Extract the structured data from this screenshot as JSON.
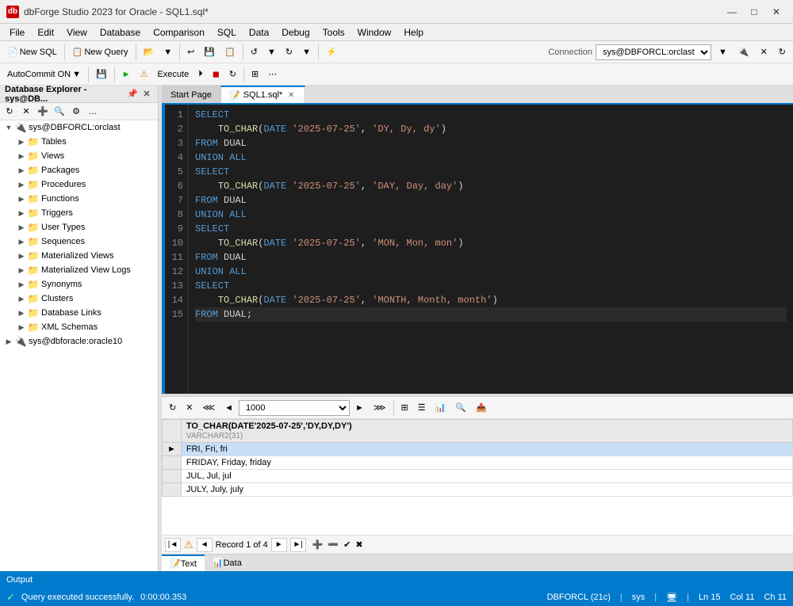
{
  "titlebar": {
    "icon": "db",
    "title": "dbForge Studio 2023 for Oracle - SQL1.sql*",
    "controls": [
      "minimize",
      "maximize",
      "close"
    ]
  },
  "menubar": {
    "items": [
      "File",
      "Edit",
      "View",
      "Database",
      "Comparison",
      "SQL",
      "Data",
      "Debug",
      "Tools",
      "Window",
      "Help"
    ]
  },
  "toolbar1": {
    "new_sql": "New SQL",
    "new_query": "New Query",
    "connection_label": "Connection",
    "connection_value": "sys@DBFORCL:orclast"
  },
  "toolbar2": {
    "autocommit": "AutoCommit ON",
    "execute": "Execute"
  },
  "sidebar": {
    "title": "Database Explorer - sys@DB...",
    "tree": [
      {
        "level": 1,
        "label": "sys@DBFORCL:orclast",
        "type": "connection",
        "expanded": true
      },
      {
        "level": 2,
        "label": "Tables",
        "type": "folder",
        "expanded": false
      },
      {
        "level": 2,
        "label": "Views",
        "type": "folder",
        "expanded": false
      },
      {
        "level": 2,
        "label": "Packages",
        "type": "folder",
        "expanded": false
      },
      {
        "level": 2,
        "label": "Procedures",
        "type": "folder",
        "expanded": false
      },
      {
        "level": 2,
        "label": "Functions",
        "type": "folder",
        "expanded": false
      },
      {
        "level": 2,
        "label": "Triggers",
        "type": "folder",
        "expanded": false
      },
      {
        "level": 2,
        "label": "User Types",
        "type": "folder",
        "expanded": false
      },
      {
        "level": 2,
        "label": "Sequences",
        "type": "folder",
        "expanded": false
      },
      {
        "level": 2,
        "label": "Materialized Views",
        "type": "folder",
        "expanded": false
      },
      {
        "level": 2,
        "label": "Materialized View Logs",
        "type": "folder",
        "expanded": false
      },
      {
        "level": 2,
        "label": "Synonyms",
        "type": "folder",
        "expanded": false
      },
      {
        "level": 2,
        "label": "Clusters",
        "type": "folder",
        "expanded": false
      },
      {
        "level": 2,
        "label": "Database Links",
        "type": "folder",
        "expanded": false
      },
      {
        "level": 2,
        "label": "XML Schemas",
        "type": "folder",
        "expanded": false
      },
      {
        "level": 1,
        "label": "sys@dbforacle:oracle10",
        "type": "connection",
        "expanded": false
      }
    ]
  },
  "tabs": {
    "start_page": "Start Page",
    "sql_file": "SQL1.sql*"
  },
  "editor": {
    "lines": [
      {
        "num": "1",
        "content": "SELECT",
        "tokens": [
          {
            "text": "SELECT",
            "cls": "kw"
          }
        ]
      },
      {
        "num": "2",
        "content": "    TO_CHAR(DATE '2025-07-25', 'DY, Dy, dy')",
        "tokens": [
          {
            "text": "    "
          },
          {
            "text": "TO_CHAR",
            "cls": "fn"
          },
          {
            "text": "(",
            "cls": "punct"
          },
          {
            "text": "DATE",
            "cls": "kw"
          },
          {
            "text": " "
          },
          {
            "text": "'2025-07-25'",
            "cls": "str"
          },
          {
            "text": ", "
          },
          {
            "text": "'DY, Dy, dy'",
            "cls": "str"
          },
          {
            "text": ")",
            "cls": "punct"
          }
        ]
      },
      {
        "num": "3",
        "content": "FROM DUAL",
        "tokens": [
          {
            "text": "FROM",
            "cls": "kw"
          },
          {
            "text": " "
          },
          {
            "text": "DUAL",
            "cls": "txt"
          }
        ]
      },
      {
        "num": "4",
        "content": "UNION ALL",
        "tokens": [
          {
            "text": "UNION ALL",
            "cls": "kw"
          }
        ]
      },
      {
        "num": "5",
        "content": "SELECT",
        "tokens": [
          {
            "text": "SELECT",
            "cls": "kw"
          }
        ]
      },
      {
        "num": "6",
        "content": "    TO_CHAR(DATE '2025-07-25', 'DAY, Day, day')",
        "tokens": [
          {
            "text": "    "
          },
          {
            "text": "TO_CHAR",
            "cls": "fn"
          },
          {
            "text": "(",
            "cls": "punct"
          },
          {
            "text": "DATE",
            "cls": "kw"
          },
          {
            "text": " "
          },
          {
            "text": "'2025-07-25'",
            "cls": "str"
          },
          {
            "text": ", "
          },
          {
            "text": "'DAY, Day, day'",
            "cls": "str"
          },
          {
            "text": ")",
            "cls": "punct"
          }
        ]
      },
      {
        "num": "7",
        "content": "FROM DUAL",
        "tokens": [
          {
            "text": "FROM",
            "cls": "kw"
          },
          {
            "text": " "
          },
          {
            "text": "DUAL",
            "cls": "txt"
          }
        ]
      },
      {
        "num": "8",
        "content": "UNION ALL",
        "tokens": [
          {
            "text": "UNION ALL",
            "cls": "kw"
          }
        ]
      },
      {
        "num": "9",
        "content": "SELECT",
        "tokens": [
          {
            "text": "SELECT",
            "cls": "kw"
          }
        ]
      },
      {
        "num": "10",
        "content": "    TO_CHAR(DATE '2025-07-25', 'MON, Mon, mon')",
        "tokens": [
          {
            "text": "    "
          },
          {
            "text": "TO_CHAR",
            "cls": "fn"
          },
          {
            "text": "(",
            "cls": "punct"
          },
          {
            "text": "DATE",
            "cls": "kw"
          },
          {
            "text": " "
          },
          {
            "text": "'2025-07-25'",
            "cls": "str"
          },
          {
            "text": ", "
          },
          {
            "text": "'MON, Mon, mon'",
            "cls": "str"
          },
          {
            "text": ")",
            "cls": "punct"
          }
        ]
      },
      {
        "num": "11",
        "content": "FROM DUAL",
        "tokens": [
          {
            "text": "FROM",
            "cls": "kw"
          },
          {
            "text": " "
          },
          {
            "text": "DUAL",
            "cls": "txt"
          }
        ]
      },
      {
        "num": "12",
        "content": "UNION ALL",
        "tokens": [
          {
            "text": "UNION ALL",
            "cls": "kw"
          }
        ]
      },
      {
        "num": "13",
        "content": "SELECT",
        "tokens": [
          {
            "text": "SELECT",
            "cls": "kw"
          }
        ]
      },
      {
        "num": "14",
        "content": "    TO_CHAR(DATE '2025-07-25', 'MONTH, Month, month')",
        "tokens": [
          {
            "text": "    "
          },
          {
            "text": "TO_CHAR",
            "cls": "fn"
          },
          {
            "text": "(",
            "cls": "punct"
          },
          {
            "text": "DATE",
            "cls": "kw"
          },
          {
            "text": " "
          },
          {
            "text": "'2025-07-25'",
            "cls": "str"
          },
          {
            "text": ", "
          },
          {
            "text": "'MONTH, Month, month'",
            "cls": "str"
          },
          {
            "text": ")",
            "cls": "punct"
          }
        ]
      },
      {
        "num": "15",
        "content": "FROM DUAL;",
        "tokens": [
          {
            "text": "FROM",
            "cls": "kw"
          },
          {
            "text": " "
          },
          {
            "text": "DUAL",
            "cls": "txt"
          },
          {
            "text": ";",
            "cls": "punct"
          }
        ],
        "is_current": true
      }
    ]
  },
  "results": {
    "toolbar": {
      "limit_value": "1000"
    },
    "column_header": "TO_CHAR(DATE'2025-07-25','DY,DY,DY')",
    "column_type": "VARCHAR2(31)",
    "rows": [
      {
        "selected": true,
        "value": "FRI, Fri, fri"
      },
      {
        "selected": false,
        "value": "FRIDAY, Friday, friday"
      },
      {
        "selected": false,
        "value": "JUL, Jul, jul"
      },
      {
        "selected": false,
        "value": "JULY, July, july"
      }
    ],
    "pager": {
      "record_text": "Record 1 of 4"
    }
  },
  "bottom_tabs": {
    "items": [
      "Text",
      "Data"
    ]
  },
  "statusbar": {
    "check_icon": "✓",
    "status_text": "Query executed successfully.",
    "time": "0:00:00.353",
    "db": "DBFORCL (21c)",
    "user": "sys",
    "ln": "Ln 15",
    "col": "Col 11",
    "ch": "Ch 11"
  },
  "output_tab": "Output"
}
